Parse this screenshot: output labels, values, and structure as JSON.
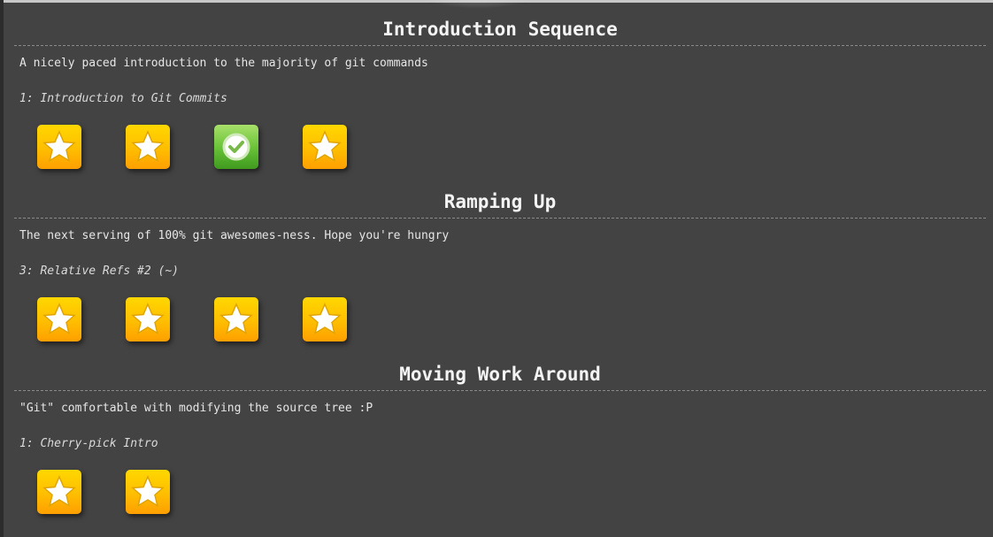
{
  "sequences": [
    {
      "title": "Introduction Sequence",
      "description": "A nicely paced introduction to the majority of git commands",
      "hovered_level": "1: Introduction to Git Commits",
      "levels": [
        {
          "status": "star",
          "icon": "star-icon"
        },
        {
          "status": "star",
          "icon": "star-icon"
        },
        {
          "status": "completed",
          "icon": "checkmark-icon"
        },
        {
          "status": "star",
          "icon": "star-icon"
        }
      ]
    },
    {
      "title": "Ramping Up",
      "description": "The next serving of 100% git awesomes-ness. Hope you're hungry",
      "hovered_level": "3: Relative Refs #2 (~)",
      "levels": [
        {
          "status": "star",
          "icon": "star-icon"
        },
        {
          "status": "star",
          "icon": "star-icon"
        },
        {
          "status": "star",
          "icon": "star-icon"
        },
        {
          "status": "star",
          "icon": "star-icon"
        }
      ]
    },
    {
      "title": "Moving Work Around",
      "description": "\"Git\" comfortable with modifying the source tree :P",
      "hovered_level": "1: Cherry-pick Intro",
      "levels": [
        {
          "status": "star",
          "icon": "star-icon"
        },
        {
          "status": "star",
          "icon": "star-icon"
        }
      ]
    }
  ],
  "colors": {
    "background": "#434343",
    "star_button": "#ffbe00",
    "completed_button": "#6cc43a"
  }
}
